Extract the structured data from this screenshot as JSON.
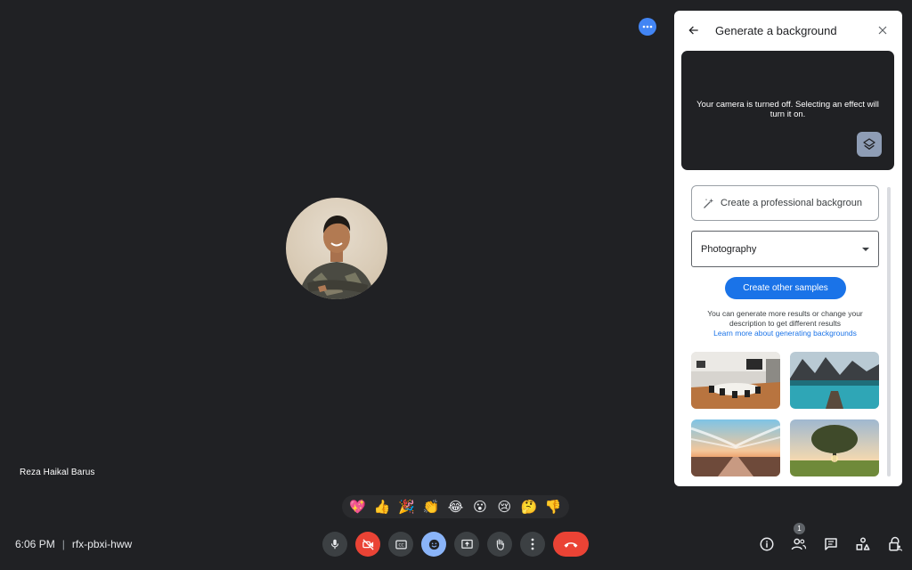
{
  "stage": {
    "participant_name": "Reza Haikal Barus",
    "more_options_icon": "more-horiz-icon"
  },
  "reactions": [
    {
      "name": "sparkling-heart",
      "glyph": "💖"
    },
    {
      "name": "thumbs-up",
      "glyph": "👍"
    },
    {
      "name": "party-popper",
      "glyph": "🎉"
    },
    {
      "name": "clapping-hands",
      "glyph": "👏"
    },
    {
      "name": "tears-of-joy",
      "glyph": "😂"
    },
    {
      "name": "surprised-face",
      "glyph": "😮"
    },
    {
      "name": "sad-face",
      "glyph": "😢"
    },
    {
      "name": "thinking-face",
      "glyph": "🤔"
    },
    {
      "name": "thumbs-down",
      "glyph": "👎"
    }
  ],
  "meeting": {
    "time": "6:06 PM",
    "separator": "|",
    "code": "rfx-pbxi-hww"
  },
  "controls": {
    "mic": "microphone-icon",
    "camera": "camera-off-icon",
    "captions": "closed-captions-icon",
    "reactions": "emoji-icon",
    "present": "present-screen-icon",
    "raise_hand": "raise-hand-icon",
    "more": "more-vert-icon",
    "leave": "end-call-icon"
  },
  "right_controls": {
    "people_count": "1"
  },
  "panel": {
    "title": "Generate a background",
    "preview_message": "Your camera is turned off. Selecting an effect will turn it on.",
    "prompt_text": "Create a professional backgroun",
    "style_selected": "Photography",
    "primary_button": "Create other samples",
    "help_text": "You can generate more results or change your description to get different results",
    "help_link": "Learn more about generating backgrounds"
  },
  "colors": {
    "background": "#202124",
    "accent": "#1a73e8",
    "danger": "#ea4335",
    "active": "#8ab4f8"
  }
}
